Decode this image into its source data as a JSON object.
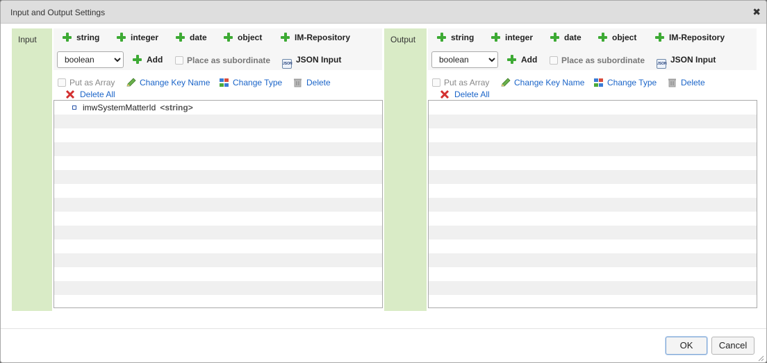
{
  "dialog": {
    "title": "Input and Output Settings",
    "close_glyph": "✖",
    "ok_label": "OK",
    "cancel_label": "Cancel"
  },
  "input": {
    "label": "Input",
    "type_buttons": {
      "string": "string",
      "integer": "integer",
      "date": "date",
      "object": "object",
      "repo": "IM-Repository"
    },
    "select_value": "boolean",
    "add_label": "Add",
    "subordinate_label": "Place as subordinate",
    "json_label": "JSON Input",
    "json_icon_text": "JSON",
    "array_label": "Put as Array",
    "change_key_label": "Change Key Name",
    "change_type_label": "Change Type",
    "delete_label": "Delete",
    "delete_all_label": "Delete All",
    "node": {
      "name": "imwSystemMatterId",
      "type": "<string>"
    }
  },
  "output": {
    "label": "Output",
    "type_buttons": {
      "string": "string",
      "integer": "integer",
      "date": "date",
      "object": "object",
      "repo": "IM-Repository"
    },
    "select_value": "boolean",
    "add_label": "Add",
    "subordinate_label": "Place as subordinate",
    "json_label": "JSON Input",
    "json_icon_text": "JSON",
    "array_label": "Put as Array",
    "change_key_label": "Change Key Name",
    "change_type_label": "Change Type",
    "delete_label": "Delete",
    "delete_all_label": "Delete All"
  },
  "colors": {
    "side_panel": "#d9ebc6",
    "plus_icon": "#3daa34",
    "link": "#1a64c8"
  }
}
